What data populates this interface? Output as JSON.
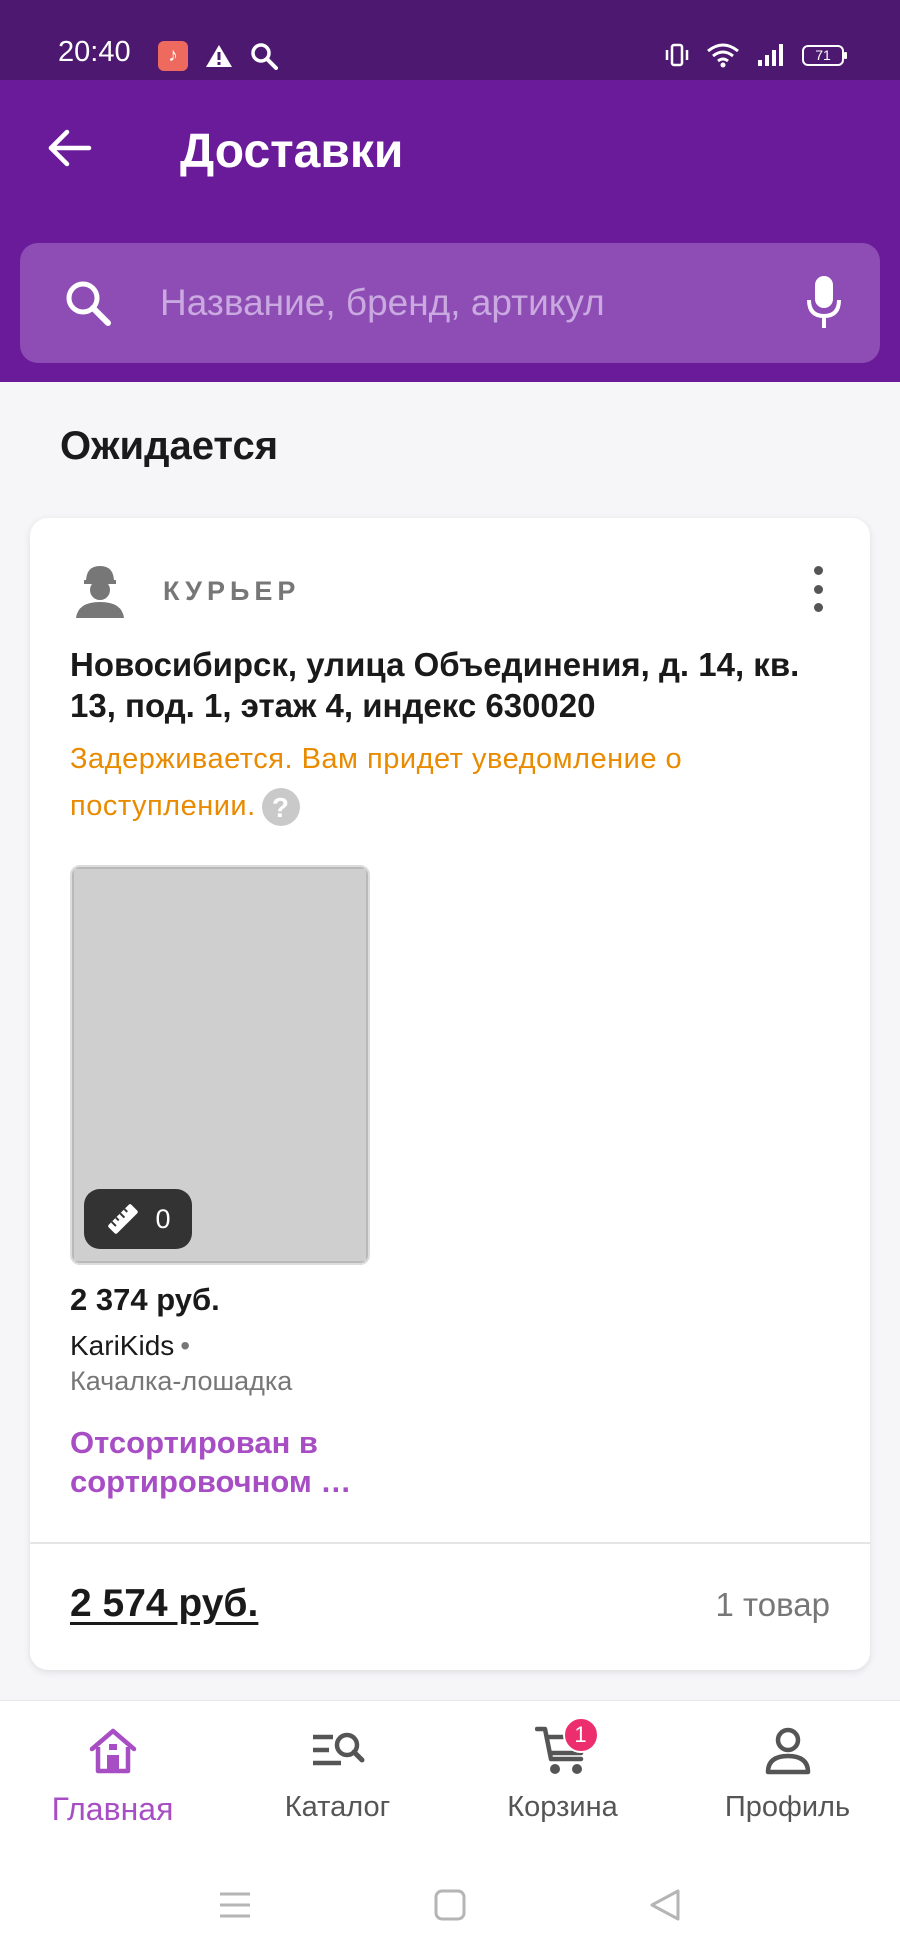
{
  "status_bar": {
    "time": "20:40",
    "battery": "71",
    "icons_left": [
      "music-app-icon",
      "warning-icon",
      "search-icon"
    ],
    "icons_right": [
      "vibrate-icon",
      "wifi-icon",
      "signal-icon",
      "battery-icon"
    ]
  },
  "header": {
    "title": "Доставки",
    "back_icon": "arrow-back-icon"
  },
  "search": {
    "placeholder": "Название, бренд, артикул",
    "value": "",
    "icons": [
      "search-icon",
      "mic-icon"
    ]
  },
  "section": {
    "title": "Ожидается"
  },
  "delivery": {
    "method": "КУРЬЕР",
    "address": "Новосибирск, улица Объединения, д. 14, кв. 13, под. 1, этаж 4, индекс 630020",
    "status_note": "Задерживается. Вам придет уведомление о поступлении.",
    "help_symbol": "?",
    "product": {
      "size_badge_count": "0",
      "price": "2 374 руб.",
      "brand": "KariKids",
      "brand_separator": "•",
      "name": "Качалка-лошадка",
      "status": "Отсортирован в сортировочном …"
    },
    "total": "2 574 руб.",
    "items_count": "1 товар"
  },
  "colors": {
    "header_bg": "#6a1b9a",
    "status_bar_bg": "#4d1970",
    "accent": "#a84ec4",
    "warning_text": "#e98b00",
    "badge": "#ec2e6e"
  },
  "bottom_nav": {
    "items": [
      {
        "label": "Главная",
        "icon": "home-icon",
        "active": true
      },
      {
        "label": "Каталог",
        "icon": "catalog-icon",
        "active": false
      },
      {
        "label": "Корзина",
        "icon": "cart-icon",
        "active": false,
        "badge": "1"
      },
      {
        "label": "Профиль",
        "icon": "profile-icon",
        "active": false
      }
    ]
  },
  "system_nav": [
    "menu-icon",
    "home-square-icon",
    "back-triangle-icon"
  ]
}
